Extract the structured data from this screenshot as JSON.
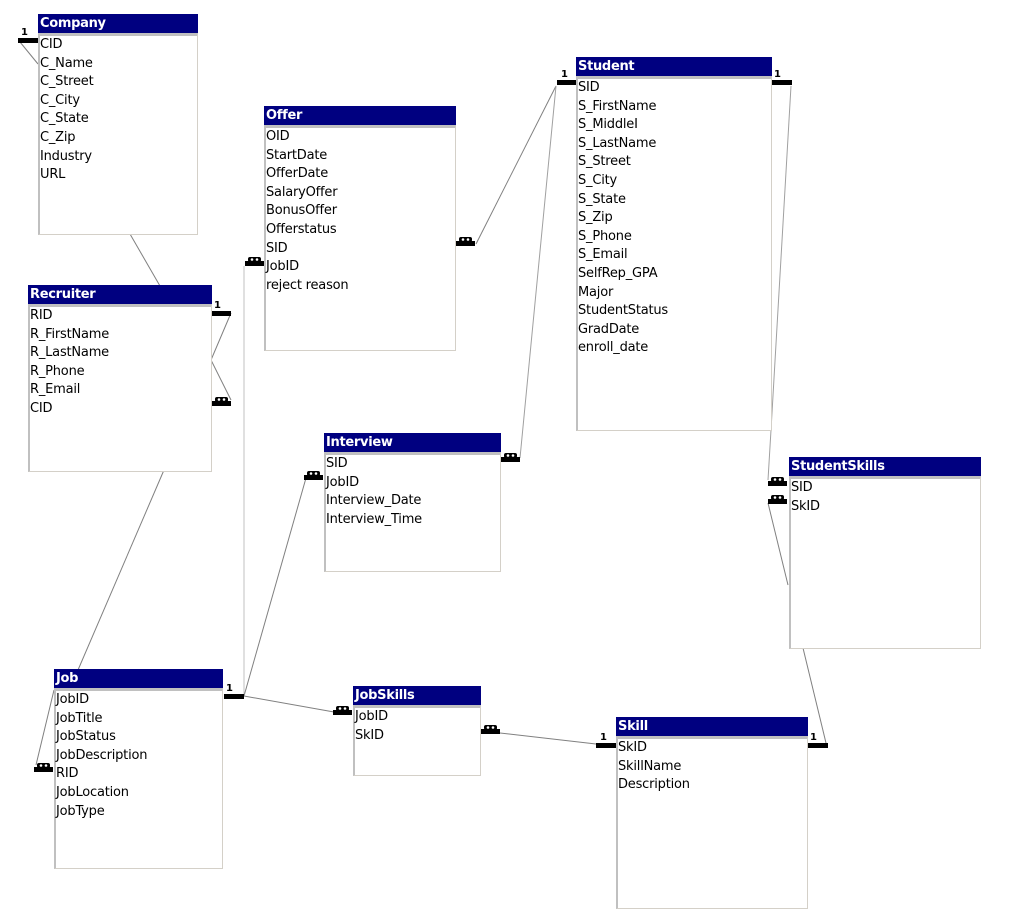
{
  "diagram": {
    "title_color": "#000080",
    "tables": [
      {
        "id": "company",
        "name": "Company",
        "fields": [
          "CID",
          "C_Name",
          "C_Street",
          "C_City",
          "C_State",
          "C_Zip",
          "Industry",
          "URL"
        ]
      },
      {
        "id": "offer",
        "name": "Offer",
        "fields": [
          "OID",
          "StartDate",
          "OfferDate",
          "SalaryOffer",
          "BonusOffer",
          "Offerstatus",
          "SID",
          "JobID",
          "reject reason"
        ]
      },
      {
        "id": "student",
        "name": "Student",
        "fields": [
          "SID",
          "S_FirstName",
          "S_MiddleI",
          "S_LastName",
          "S_Street",
          "S_City",
          "S_State",
          "S_Zip",
          "S_Phone",
          "S_Email",
          "SelfRep_GPA",
          "Major",
          "StudentStatus",
          "GradDate",
          "enroll_date"
        ]
      },
      {
        "id": "recruiter",
        "name": "Recruiter",
        "fields": [
          "RID",
          "R_FirstName",
          "R_LastName",
          "R_Phone",
          "R_Email",
          "CID"
        ]
      },
      {
        "id": "interview",
        "name": "Interview",
        "fields": [
          "SID",
          "JobID",
          "Interview_Date",
          "Interview_Time"
        ]
      },
      {
        "id": "studentskills",
        "name": "StudentSkills",
        "fields": [
          "SID",
          "SkID"
        ]
      },
      {
        "id": "job",
        "name": "Job",
        "fields": [
          "JobID",
          "JobTitle",
          "JobStatus",
          "JobDescription",
          "RID",
          "JobLocation",
          "JobType"
        ]
      },
      {
        "id": "jobskills",
        "name": "JobSkills",
        "fields": [
          "JobID",
          "SkID"
        ]
      },
      {
        "id": "skill",
        "name": "Skill",
        "fields": [
          "SkID",
          "SkillName",
          "Description"
        ]
      }
    ],
    "relationships": [
      {
        "from": "Company.CID",
        "to": "Recruiter.CID",
        "from_card": "1",
        "to_card": "many"
      },
      {
        "from": "Student.SID",
        "to": "Offer.SID",
        "from_card": "1",
        "to_card": "many"
      },
      {
        "from": "Student.SID",
        "to": "Interview.SID",
        "from_card": "1",
        "to_card": "many"
      },
      {
        "from": "Student.SID",
        "to": "StudentSkills.SID",
        "from_card": "1",
        "to_card": "many"
      },
      {
        "from": "Recruiter.RID",
        "to": "Job.RID",
        "from_card": "1",
        "to_card": "many"
      },
      {
        "from": "Job.JobID",
        "to": "Offer.JobID",
        "from_card": "1",
        "to_card": "many"
      },
      {
        "from": "Job.JobID",
        "to": "Interview.JobID",
        "from_card": "1",
        "to_card": "many"
      },
      {
        "from": "Job.JobID",
        "to": "JobSkills.JobID",
        "from_card": "1",
        "to_card": "many"
      },
      {
        "from": "Skill.SkID",
        "to": "JobSkills.SkID",
        "from_card": "1",
        "to_card": "many"
      },
      {
        "from": "Skill.SkID",
        "to": "StudentSkills.SkID",
        "from_card": "1",
        "to_card": "many"
      }
    ],
    "one_label": "1"
  }
}
